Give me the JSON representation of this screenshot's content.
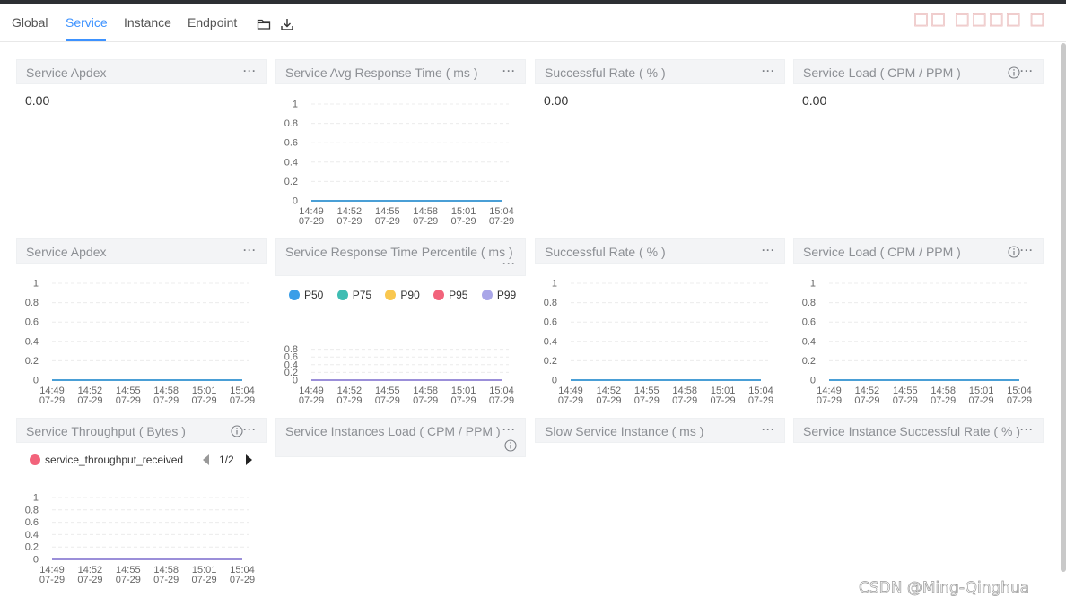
{
  "tabs": [
    {
      "label": "Global"
    },
    {
      "label": "Service"
    },
    {
      "label": "Instance"
    },
    {
      "label": "Endpoint"
    }
  ],
  "active_tab": "Service",
  "toolbar_icons": [
    "folder-icon",
    "download-icon"
  ],
  "colors": {
    "accent": "#3d92ff",
    "line_flat": "#4a9fd6",
    "line_purple": "#9b8fd9",
    "p50": "#3a9ee8",
    "p75": "#3fbdb3",
    "p90": "#f9c74f",
    "p95": "#f2637b",
    "p99": "#a9a6e8",
    "throughput": "#f2637b"
  },
  "x_ticks": [
    {
      "time": "14:49",
      "date": "07-29"
    },
    {
      "time": "14:52",
      "date": "07-29"
    },
    {
      "time": "14:55",
      "date": "07-29"
    },
    {
      "time": "14:58",
      "date": "07-29"
    },
    {
      "time": "15:01",
      "date": "07-29"
    },
    {
      "time": "15:04",
      "date": "07-29"
    }
  ],
  "cards": {
    "r1c1": {
      "title": "Service Apdex",
      "value": "0.00"
    },
    "r1c2": {
      "title": "Service Avg Response Time ( ms )"
    },
    "r1c3": {
      "title": "Successful Rate ( % )",
      "value": "0.00"
    },
    "r1c4": {
      "title": "Service Load ( CPM / PPM )",
      "value": "0.00"
    },
    "r2c1": {
      "title": "Service Apdex"
    },
    "r2c2": {
      "title": "Service Response Time Percentile ( ms )",
      "legend": [
        "P50",
        "P75",
        "P90",
        "P95",
        "P99"
      ]
    },
    "r2c3": {
      "title": "Successful Rate ( % )"
    },
    "r2c4": {
      "title": "Service Load ( CPM / PPM )"
    },
    "r3c1": {
      "title": "Service Throughput ( Bytes )",
      "legend": [
        "service_throughput_received"
      ],
      "pager": "1/2"
    },
    "r3c2": {
      "title": "Service Instances Load ( CPM / PPM )"
    },
    "r3c3": {
      "title": "Slow Service Instance ( ms )"
    },
    "r3c4": {
      "title": "Service Instance Successful Rate ( % )"
    }
  },
  "more_label": "···",
  "chart_data": [
    {
      "type": "line",
      "title": "Service Avg Response Time ( ms )",
      "y_ticks": [
        "1",
        "0.8",
        "0.6",
        "0.4",
        "0.2",
        "0"
      ],
      "ylim": [
        0,
        1
      ],
      "x": [
        "14:49",
        "14:52",
        "14:55",
        "14:58",
        "15:01",
        "15:04"
      ],
      "series": [
        {
          "values": [
            0,
            0,
            0,
            0,
            0,
            0
          ]
        }
      ],
      "grid": true
    },
    {
      "type": "line",
      "title": "Service Apdex",
      "y_ticks": [
        "1",
        "0.8",
        "0.6",
        "0.4",
        "0.2",
        "0"
      ],
      "ylim": [
        0,
        1
      ],
      "x": [
        "14:49",
        "14:52",
        "14:55",
        "14:58",
        "15:01",
        "15:04"
      ],
      "series": [
        {
          "values": [
            0,
            0,
            0,
            0,
            0,
            0
          ]
        }
      ],
      "grid": true
    },
    {
      "type": "line",
      "title": "Service Response Time Percentile ( ms )",
      "y_ticks": [
        "0.8",
        "0.6",
        "0.4",
        "0.2",
        "0"
      ],
      "ylim": [
        0,
        1
      ],
      "x": [
        "14:49",
        "14:52",
        "14:55",
        "14:58",
        "15:01",
        "15:04"
      ],
      "series": [
        {
          "name": "P50",
          "values": [
            0,
            0,
            0,
            0,
            0,
            0
          ]
        },
        {
          "name": "P75",
          "values": [
            0,
            0,
            0,
            0,
            0,
            0
          ]
        },
        {
          "name": "P90",
          "values": [
            0,
            0,
            0,
            0,
            0,
            0
          ]
        },
        {
          "name": "P95",
          "values": [
            0,
            0,
            0,
            0,
            0,
            0
          ]
        },
        {
          "name": "P99",
          "values": [
            0,
            0,
            0,
            0,
            0,
            0
          ]
        }
      ],
      "legend": "top",
      "grid": true
    },
    {
      "type": "line",
      "title": "Successful Rate ( % )",
      "y_ticks": [
        "1",
        "0.8",
        "0.6",
        "0.4",
        "0.2",
        "0"
      ],
      "ylim": [
        0,
        1
      ],
      "x": [
        "14:49",
        "14:52",
        "14:55",
        "14:58",
        "15:01",
        "15:04"
      ],
      "series": [
        {
          "values": [
            0,
            0,
            0,
            0,
            0,
            0
          ]
        }
      ],
      "grid": true
    },
    {
      "type": "line",
      "title": "Service Load ( CPM / PPM )",
      "y_ticks": [
        "1",
        "0.8",
        "0.6",
        "0.4",
        "0.2",
        "0"
      ],
      "ylim": [
        0,
        1
      ],
      "x": [
        "14:49",
        "14:52",
        "14:55",
        "14:58",
        "15:01",
        "15:04"
      ],
      "series": [
        {
          "values": [
            0,
            0,
            0,
            0,
            0,
            0
          ]
        }
      ],
      "grid": true
    },
    {
      "type": "line",
      "title": "Service Throughput ( Bytes )",
      "y_ticks": [
        "1",
        "0.8",
        "0.6",
        "0.4",
        "0.2",
        "0"
      ],
      "ylim": [
        0,
        1
      ],
      "x": [
        "14:49",
        "14:52",
        "14:55",
        "14:58",
        "15:01",
        "15:04"
      ],
      "series": [
        {
          "name": "service_throughput_received",
          "values": [
            0,
            0,
            0,
            0,
            0,
            0
          ]
        }
      ],
      "legend": "top",
      "grid": true
    }
  ],
  "watermark": "CSDN @Ming-Qinghua"
}
